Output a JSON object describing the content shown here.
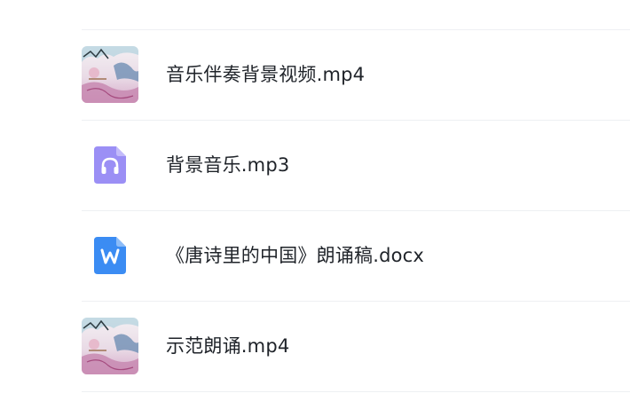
{
  "files": [
    {
      "name": "音乐伴奏背景视频.mp4",
      "type": "video",
      "icon": "video-thumbnail"
    },
    {
      "name": "背景音乐.mp3",
      "type": "audio",
      "icon": "headphones-icon",
      "icon_color": "#9b8ff5"
    },
    {
      "name": "《唐诗里的中国》朗诵稿.docx",
      "type": "document",
      "icon": "word-doc-icon",
      "icon_color": "#3b8cf3"
    },
    {
      "name": "示范朗诵.mp4",
      "type": "video",
      "icon": "video-thumbnail"
    }
  ]
}
